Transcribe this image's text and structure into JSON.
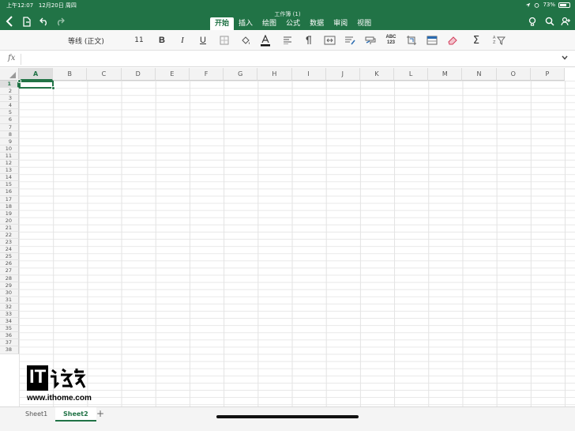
{
  "status": {
    "time": "上午12:07",
    "date": "12月20日 周四",
    "battery": "73%",
    "battery_level": 0.73
  },
  "window": {
    "title": "工作簿 (1)"
  },
  "ribbon": {
    "tabs": [
      "开始",
      "插入",
      "绘图",
      "公式",
      "数据",
      "审阅",
      "视图"
    ],
    "active_tab": 0
  },
  "toolbar": {
    "font_name": "等线 (正文)",
    "font_size": "11",
    "bold": "B",
    "italic": "I",
    "underline": "U",
    "spellcheck": "ABC\n123",
    "sum": "Σ",
    "sort_label": "A Z"
  },
  "formula_bar": {
    "fx": "fx",
    "value": ""
  },
  "grid": {
    "columns": [
      "A",
      "B",
      "C",
      "D",
      "E",
      "F",
      "G",
      "H",
      "I",
      "J",
      "K",
      "L",
      "M",
      "N",
      "O",
      "P"
    ],
    "rows": [
      "1",
      "2",
      "3",
      "4",
      "5",
      "6",
      "7",
      "8",
      "9",
      "10",
      "11",
      "12",
      "13",
      "14",
      "15",
      "16",
      "17",
      "18",
      "19",
      "20",
      "21",
      "22",
      "23",
      "24",
      "25",
      "26",
      "27",
      "28",
      "29",
      "30",
      "31",
      "32",
      "33",
      "34",
      "35",
      "36",
      "37",
      "38"
    ],
    "selected_cell": "A1"
  },
  "watermark": {
    "url": "www.ithome.com",
    "logo": "IT之家"
  },
  "sheets": {
    "tabs": [
      "Sheet1",
      "Sheet2"
    ],
    "active": 1,
    "add": "+"
  },
  "colors": {
    "accent": "#217346",
    "grid": "#e3e3e3"
  }
}
